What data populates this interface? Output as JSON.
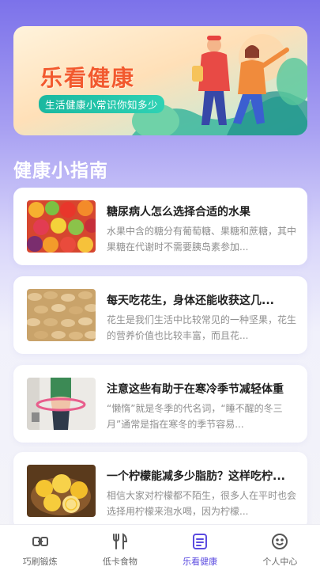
{
  "banner": {
    "title": "乐看健康",
    "subtitle": "生活健康小常识你知多少"
  },
  "section": {
    "title": "健康小指南"
  },
  "articles": [
    {
      "title": "糖尿病人怎么选择合适的水果",
      "desc": "水果中含的糖分有葡萄糖、果糖和蔗糖，其中果糖在代谢时不需要胰岛素参加...",
      "image": "fruits"
    },
    {
      "title": "每天吃花生，身体还能收获这几...",
      "desc": "花生是我们生活中比较常见的一种坚果，花生的营养价值也比较丰富，而且花...",
      "image": "peanuts"
    },
    {
      "title": "注意这些有助于在寒冷季节减轻体重",
      "desc": "“懒惰”就是冬季的代名词，“睡不醒的冬三月”通常是指在寒冬的季节容易...",
      "image": "hula-hoop"
    },
    {
      "title": "一个柠檬能减多少脂肪？这样吃柠...",
      "desc": "相信大家对柠檬都不陌生，很多人在平时也会选择用柠檬来泡水喝，因为柠檬...",
      "image": "lemons"
    }
  ],
  "tabs": [
    {
      "label": "巧刷锻炼",
      "icon": "link-icon",
      "active": false
    },
    {
      "label": "低卡食物",
      "icon": "fork-knife-icon",
      "active": false
    },
    {
      "label": "乐看健康",
      "icon": "list-icon",
      "active": true
    },
    {
      "label": "个人中心",
      "icon": "face-icon",
      "active": false
    }
  ],
  "colors": {
    "accent": "#5b4be0",
    "banner_title": "#f2592e",
    "header_gradient_top": "#7c72ea"
  }
}
